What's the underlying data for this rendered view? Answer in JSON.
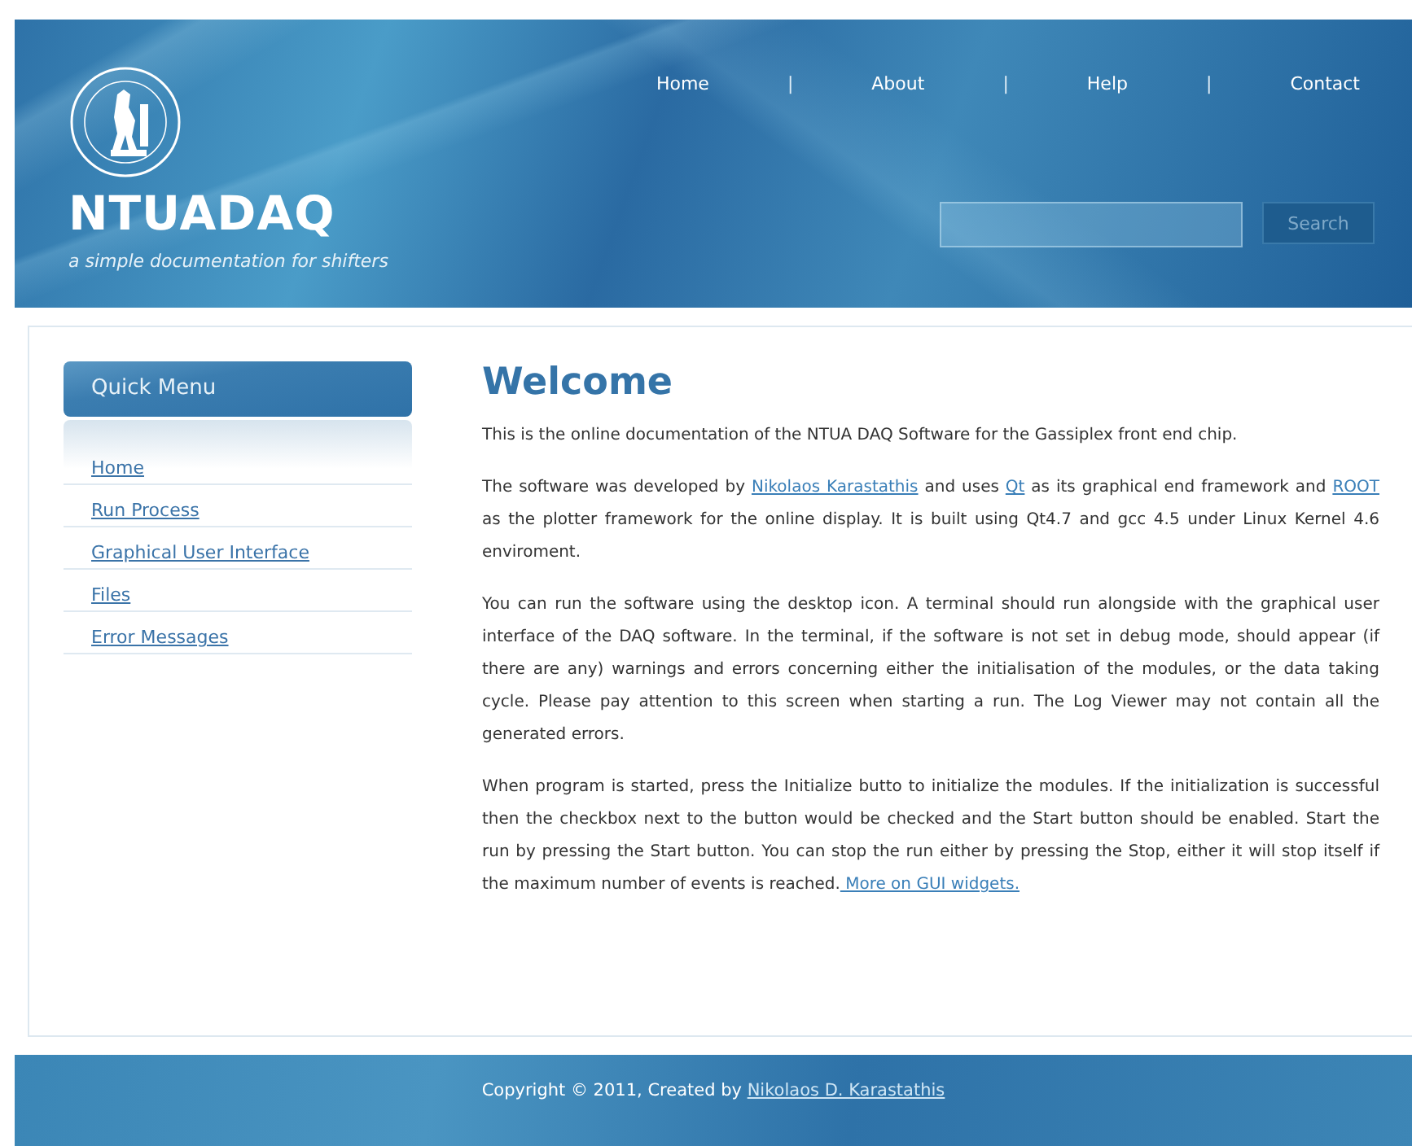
{
  "header": {
    "title": "NTUADAQ",
    "tagline": "a simple documentation for shifters",
    "nav": [
      {
        "kind": "link",
        "text": "Home"
      },
      {
        "kind": "separator",
        "text": "|"
      },
      {
        "kind": "link",
        "text": "About"
      },
      {
        "kind": "separator",
        "text": "|"
      },
      {
        "kind": "link",
        "text": "Help"
      },
      {
        "kind": "separator",
        "text": "|"
      },
      {
        "kind": "link",
        "text": "Contact"
      }
    ],
    "search": {
      "button": "Search"
    }
  },
  "sidebar": {
    "title": "Quick Menu",
    "items": [
      "Home",
      "Run Process",
      "Graphical User Interface",
      "Files",
      "Error Messages"
    ]
  },
  "main": {
    "heading": "Welcome",
    "paragraphs": [
      [
        {
          "kind": "text",
          "text": "This is the online documentation of the NTUA DAQ Software for the Gassiplex front end chip."
        }
      ],
      [
        {
          "kind": "text",
          "text": "The software was developed by "
        },
        {
          "kind": "link",
          "text": "Nikolaos Karastathis"
        },
        {
          "kind": "text",
          "text": " and uses "
        },
        {
          "kind": "link",
          "text": "Qt"
        },
        {
          "kind": "text",
          "text": " as its graphical end framework and "
        },
        {
          "kind": "link",
          "text": "ROOT"
        },
        {
          "kind": "text",
          "text": " as the plotter framework for the online display. It is built using Qt4.7 and gcc 4.5 under Linux Kernel 4.6 enviroment."
        }
      ],
      [
        {
          "kind": "text",
          "text": "You can run the software using the desktop icon. A terminal should run alongside with the graphical user interface of the DAQ software. In the terminal, if the software is not set in debug mode, should appear (if there are any) warnings and errors concerning either the initialisation of the modules, or the data taking cycle. Please pay attention to this screen when starting a run. The Log Viewer may not contain all the generated errors."
        }
      ],
      [
        {
          "kind": "text",
          "text": "When program is started, press the Initialize butto  to initialize the modules. If the initialization is successful then the checkbox next to the button would be checked and the Start button should be enabled. Start the run by pressing the Start button. You can stop the run either by pressing the Stop, either it will stop itself if the maximum number of events is reached."
        },
        {
          "kind": "link",
          "text": " More on GUI widgets."
        }
      ]
    ]
  },
  "footer": [
    {
      "kind": "text",
      "text": "Copyright © 2011, Created by "
    },
    {
      "kind": "link",
      "text": "Nikolaos D. Karastathis"
    }
  ]
}
